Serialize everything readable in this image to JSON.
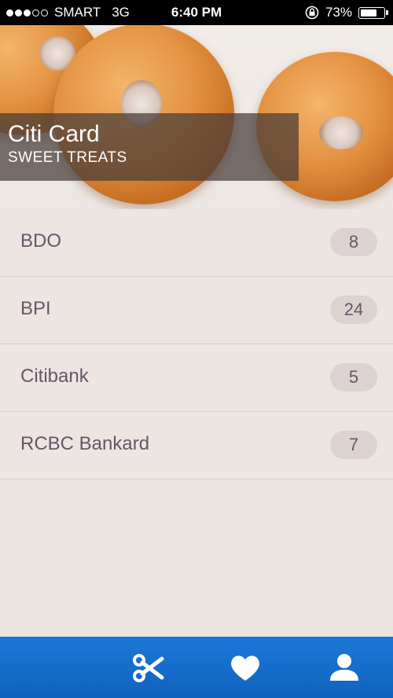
{
  "status_bar": {
    "carrier": "SMART",
    "network": "3G",
    "time": "6:40 PM",
    "battery": "73%",
    "battery_level": 0.73,
    "signal_bars_filled": 3,
    "signal_bars_total": 5
  },
  "header": {
    "title": "Citi Card",
    "subtitle": "SWEET TREATS"
  },
  "banks": [
    {
      "name": "BDO",
      "count": "8"
    },
    {
      "name": "BPI",
      "count": "24"
    },
    {
      "name": "Citibank",
      "count": "5"
    },
    {
      "name": "RCBC Bankard",
      "count": "7"
    }
  ],
  "tab_bar": {
    "items": [
      {
        "icon": "scissors-icon"
      },
      {
        "icon": "heart-icon"
      },
      {
        "icon": "user-icon"
      }
    ],
    "color": "#1b78d8"
  }
}
